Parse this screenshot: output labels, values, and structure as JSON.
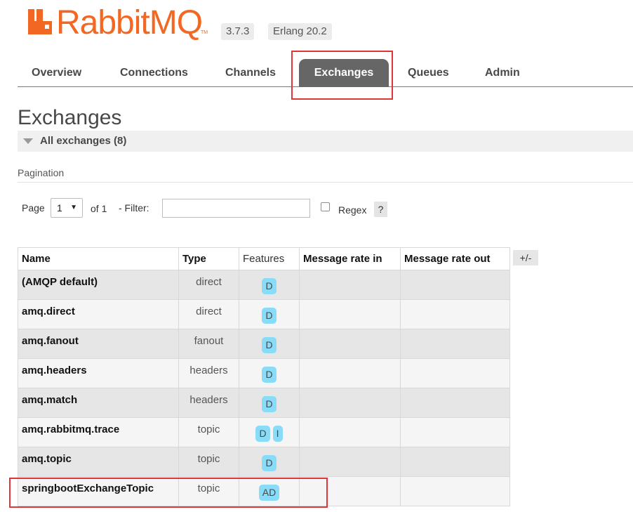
{
  "brand": {
    "name": "RabbitMQ",
    "trademark": "TM",
    "color": "#f26822"
  },
  "versions": {
    "rabbitmq": "3.7.3",
    "erlang": "Erlang 20.2"
  },
  "tabs": [
    {
      "label": "Overview",
      "active": false
    },
    {
      "label": "Connections",
      "active": false
    },
    {
      "label": "Channels",
      "active": false
    },
    {
      "label": "Exchanges",
      "active": true
    },
    {
      "label": "Queues",
      "active": false
    },
    {
      "label": "Admin",
      "active": false
    }
  ],
  "page": {
    "title": "Exchanges",
    "section_label": "All exchanges (8)",
    "pagination_heading": "Pagination"
  },
  "pagination": {
    "page_label": "Page",
    "page_value": "1",
    "of_label": "of 1",
    "filter_label": "- Filter:",
    "filter_value": "",
    "regex_label": "Regex",
    "regex_checked": false,
    "help_label": "?"
  },
  "table": {
    "columns": [
      "Name",
      "Type",
      "Features",
      "Message rate in",
      "Message rate out"
    ],
    "toggle_columns_label": "+/-",
    "rows": [
      {
        "name": "(AMQP default)",
        "type": "direct",
        "features": [
          "D"
        ],
        "rate_in": "",
        "rate_out": ""
      },
      {
        "name": "amq.direct",
        "type": "direct",
        "features": [
          "D"
        ],
        "rate_in": "",
        "rate_out": ""
      },
      {
        "name": "amq.fanout",
        "type": "fanout",
        "features": [
          "D"
        ],
        "rate_in": "",
        "rate_out": ""
      },
      {
        "name": "amq.headers",
        "type": "headers",
        "features": [
          "D"
        ],
        "rate_in": "",
        "rate_out": ""
      },
      {
        "name": "amq.match",
        "type": "headers",
        "features": [
          "D"
        ],
        "rate_in": "",
        "rate_out": ""
      },
      {
        "name": "amq.rabbitmq.trace",
        "type": "topic",
        "features": [
          "D",
          "I"
        ],
        "rate_in": "",
        "rate_out": ""
      },
      {
        "name": "amq.topic",
        "type": "topic",
        "features": [
          "D"
        ],
        "rate_in": "",
        "rate_out": ""
      },
      {
        "name": "springbootExchangeTopic",
        "type": "topic",
        "features": [
          "AD"
        ],
        "rate_in": "",
        "rate_out": ""
      }
    ]
  },
  "colors": {
    "active_tab": "#666666",
    "feature_badge": "#88dcf7",
    "highlight_box": "#e0363a"
  }
}
